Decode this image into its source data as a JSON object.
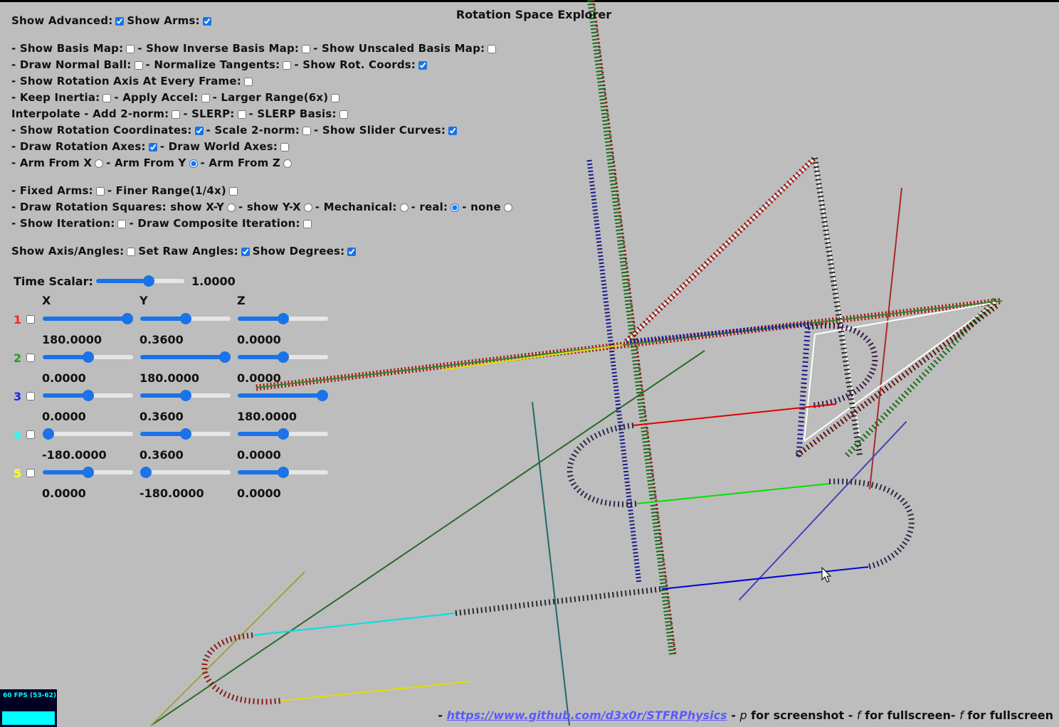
{
  "title": "Rotation Space Explorer",
  "options": {
    "show_advanced": {
      "label": "Show Advanced:",
      "checked": true
    },
    "show_arms": {
      "label": "Show Arms:",
      "checked": true
    },
    "show_basis_map": {
      "label": "- Show Basis Map:",
      "checked": false
    },
    "show_inverse_basis_map": {
      "label": "- Show Inverse Basis Map:",
      "checked": false
    },
    "show_unscaled_basis_map": {
      "label": "- Show Unscaled Basis Map:",
      "checked": false
    },
    "draw_normal_ball": {
      "label": "- Draw Normal Ball:",
      "checked": false
    },
    "normalize_tangents": {
      "label": "- Normalize Tangents:",
      "checked": false
    },
    "show_rot_coords": {
      "label": "- Show Rot. Coords:",
      "checked": true
    },
    "show_rotation_axis": {
      "label": "- Show Rotation Axis At Every Frame:",
      "checked": false
    },
    "keep_inertia": {
      "label": "- Keep Inertia:",
      "checked": false
    },
    "apply_accel": {
      "label": "- Apply Accel:",
      "checked": false
    },
    "larger_range": {
      "label": "- Larger Range(6x)",
      "checked": false
    },
    "add_2norm": {
      "label": "Interpolate - Add 2-norm:",
      "checked": false
    },
    "slerp": {
      "label": "- SLERP:",
      "checked": false
    },
    "slerp_basis": {
      "label": "- SLERP Basis:",
      "checked": false
    },
    "show_rotation_coordinates": {
      "label": "- Show Rotation Coordinates:",
      "checked": true
    },
    "scale_2norm": {
      "label": "- Scale 2-norm:",
      "checked": false
    },
    "show_slider_curves": {
      "label": "- Show Slider Curves:",
      "checked": true
    },
    "draw_rotation_axes": {
      "label": "- Draw Rotation Axes:",
      "checked": true
    },
    "draw_world_axes": {
      "label": "- Draw World Axes:",
      "checked": false
    },
    "arm_from_x": {
      "label": "- Arm From X",
      "checked": false
    },
    "arm_from_y": {
      "label": "- Arm From Y",
      "checked": true
    },
    "arm_from_z": {
      "label": "- Arm From Z",
      "checked": false
    },
    "fixed_arms": {
      "label": "- Fixed Arms:",
      "checked": false
    },
    "finer_range": {
      "label": "- Finer Range(1/4x)",
      "checked": false
    },
    "draw_rotation_squares": {
      "label": "- Draw Rotation Squares: show X-Y",
      "checked": false
    },
    "show_y_x": {
      "label": "- show Y-X",
      "checked": false
    },
    "mechanical": {
      "label": "- Mechanical:",
      "checked": false
    },
    "real": {
      "label": "- real:",
      "checked": true
    },
    "none": {
      "label": "- none",
      "checked": false
    },
    "show_iteration": {
      "label": "- Show Iteration:",
      "checked": false
    },
    "draw_composite_iteration": {
      "label": "- Draw Composite Iteration:",
      "checked": false
    },
    "show_axis_angles": {
      "label": "Show Axis/Angles:",
      "checked": false
    },
    "set_raw_angles": {
      "label": "Set Raw Angles:",
      "checked": true
    },
    "show_degrees": {
      "label": "Show Degrees:",
      "checked": true
    }
  },
  "time_scalar": {
    "label": "Time Scalar:",
    "value": "1.0000",
    "level": 0.6
  },
  "slider_headers": {
    "x": "X",
    "y": "Y",
    "z": "Z"
  },
  "rotations": [
    {
      "num": "1",
      "color": "#ff2020",
      "checked": false,
      "x": {
        "value": "180.0000",
        "level": 1.0
      },
      "y": {
        "value": "0.3600",
        "level": 0.5
      },
      "z": {
        "value": "0.0000",
        "level": 0.5
      }
    },
    {
      "num": "2",
      "color": "#20a020",
      "checked": false,
      "x": {
        "value": "0.0000",
        "level": 0.5
      },
      "y": {
        "value": "180.0000",
        "level": 1.0
      },
      "z": {
        "value": "0.0000",
        "level": 0.5
      }
    },
    {
      "num": "3",
      "color": "#2020ff",
      "checked": false,
      "x": {
        "value": "0.0000",
        "level": 0.5
      },
      "y": {
        "value": "0.3600",
        "level": 0.5
      },
      "z": {
        "value": "180.0000",
        "level": 1.0
      }
    },
    {
      "num": "4",
      "color": "#20ffff",
      "checked": false,
      "x": {
        "value": "-180.0000",
        "level": 0.0
      },
      "y": {
        "value": "0.3600",
        "level": 0.5
      },
      "z": {
        "value": "0.0000",
        "level": 0.5
      }
    },
    {
      "num": "5",
      "color": "#ffff20",
      "checked": false,
      "x": {
        "value": "0.0000",
        "level": 0.5
      },
      "y": {
        "value": "-180.0000",
        "level": 0.0
      },
      "z": {
        "value": "0.0000",
        "level": 0.5
      }
    }
  ],
  "fps": {
    "text": "60 FPS (53-62)"
  },
  "footer": {
    "prefix": "- ",
    "link": "https://www.github.com/d3x0r/STFRPhysics",
    "sep1": " - ",
    "key_p": "p",
    "screenshot": " for screenshot - ",
    "key_f1": "f",
    "fullscreen1": " for fullscreen- ",
    "key_f2": "f",
    "fullscreen2": " for fullscreen"
  }
}
